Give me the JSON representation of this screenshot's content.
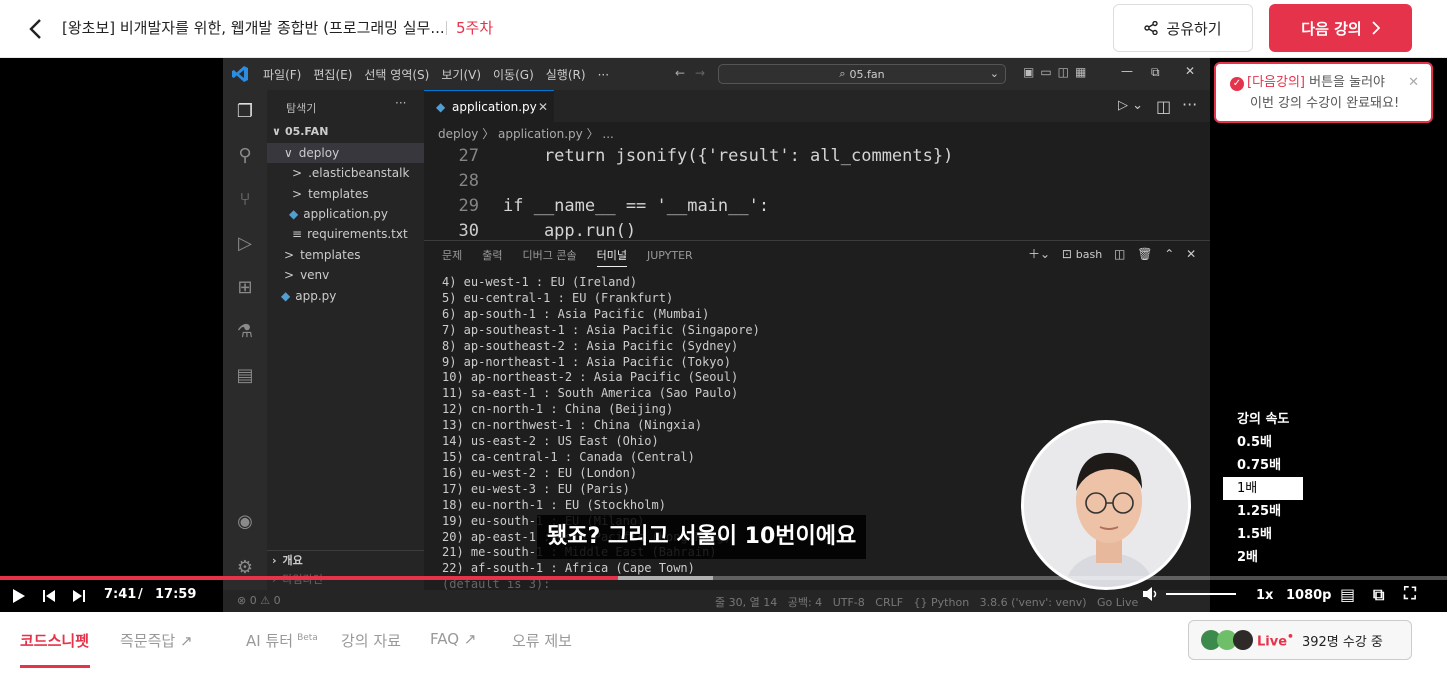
{
  "header": {
    "back_icon": "chevron-left-icon",
    "course_title": "[왕초보] 비개발자를 위한, 웹개발 종합반 (프로그래밍 실무...",
    "week": "5주차",
    "share_label": "공유하기",
    "next_label": "다음 강의"
  },
  "toast": {
    "highlight": "[다음강의]",
    "line1_rest": " 버튼을 눌러야",
    "line2": "이번 강의 수강이 완료돼요!"
  },
  "vscode": {
    "menu": [
      "파일(F)",
      "편집(E)",
      "선택 영역(S)",
      "보기(V)",
      "이동(G)",
      "실행(R)",
      "···"
    ],
    "search": "05.fan",
    "explorer_title": "탐색기",
    "explorer_more": "···",
    "tree": [
      {
        "label": "05.FAN",
        "arrow": "∨"
      },
      {
        "label": "deploy",
        "arrow": "∨"
      },
      {
        "label": ".elasticbeanstalk",
        "arrow": ">"
      },
      {
        "label": "templates",
        "arrow": ">"
      },
      {
        "label": "application.py",
        "arrow": ""
      },
      {
        "label": "requirements.txt",
        "arrow": ""
      },
      {
        "label": "templates",
        "arrow": ">"
      },
      {
        "label": "venv",
        "arrow": ">"
      },
      {
        "label": "app.py",
        "arrow": ""
      }
    ],
    "outline_label": "개요",
    "timeline_label": "타임라인",
    "tab_name": "application.py",
    "breadcrumb": "deploy  〉  application.py  〉  ...",
    "code": [
      {
        "ln": "27",
        "text": "    return jsonify({'result': all_comments})"
      },
      {
        "ln": "28",
        "text": ""
      },
      {
        "ln": "29",
        "text": "if __name__ == '__main__':"
      },
      {
        "ln": "30",
        "text": "    app.run()"
      }
    ],
    "panel_tabs": [
      "문제",
      "출력",
      "디버그 콘솔",
      "터미널",
      "JUPYTER"
    ],
    "shell": "bash",
    "terminal": [
      "4) eu-west-1 : EU (Ireland)",
      "5) eu-central-1 : EU (Frankfurt)",
      "6) ap-south-1 : Asia Pacific (Mumbai)",
      "7) ap-southeast-1 : Asia Pacific (Singapore)",
      "8) ap-southeast-2 : Asia Pacific (Sydney)",
      "9) ap-northeast-1 : Asia Pacific (Tokyo)",
      "10) ap-northeast-2 : Asia Pacific (Seoul)",
      "11) sa-east-1 : South America (Sao Paulo)",
      "12) cn-north-1 : China (Beijing)",
      "13) cn-northwest-1 : China (Ningxia)",
      "14) us-east-2 : US East (Ohio)",
      "15) ca-central-1 : Canada (Central)",
      "16) eu-west-2 : EU (London)",
      "17) eu-west-3 : EU (Paris)",
      "18) eu-north-1 : EU (Stockholm)",
      "19) eu-south-1 : EU (Milano)",
      "20) ap-east-1 : Asia Pacific (Hong Kong)",
      "21) me-south-1 : Middle East (Bahrain)",
      "22) af-south-1 : Africa (Cape Town)",
      "(default is 3):"
    ],
    "status_left": "⊗ 0 ⚠ 0",
    "status_right": [
      "줄 30, 열 14",
      "공백: 4",
      "UTF-8",
      "CRLF",
      "{} Python",
      "3.8.6 ('venv': venv)",
      "Go Live"
    ]
  },
  "player": {
    "subtitle": "됐죠? 그리고 서울이 10번이에요",
    "speed_title": "강의 속도",
    "speeds": [
      "0.5배",
      "0.75배",
      "1배",
      "1.25배",
      "1.5배",
      "2배"
    ],
    "selected_speed": "1배",
    "current_time": "7:41",
    "time_sep": "/",
    "duration": "17:59",
    "progress_fraction": 0.427,
    "speed_label": "1x",
    "quality": "1080p"
  },
  "bottom_tabs": {
    "snippet": "코드스니펫",
    "qna": "즉문즉답",
    "ai_tutor": "AI 튜터",
    "beta": "Beta",
    "materials": "강의 자료",
    "faq": "FAQ",
    "report": "오류 제보"
  },
  "live": {
    "label": "Live",
    "dot": "•",
    "count": "392명 수강 중"
  },
  "colors": {
    "brand": "#e5334b",
    "vscode_bg": "#1e1e1e"
  }
}
